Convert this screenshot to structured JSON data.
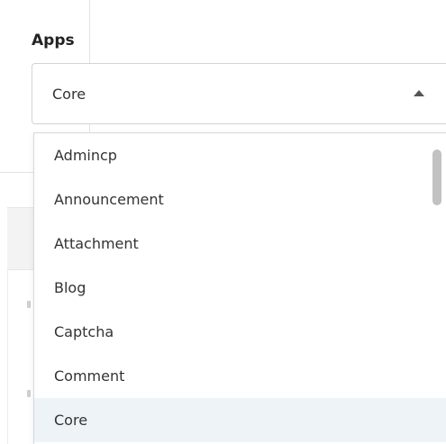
{
  "field": {
    "label": "Apps",
    "selected_value": "Core"
  },
  "dropdown": {
    "options": [
      {
        "label": "Admincp"
      },
      {
        "label": "Announcement"
      },
      {
        "label": "Attachment"
      },
      {
        "label": "Blog"
      },
      {
        "label": "Captcha"
      },
      {
        "label": "Comment"
      },
      {
        "label": "Core"
      }
    ],
    "selected_index": 6,
    "highlight_color": "#eef3f8"
  },
  "icons": {
    "toggle": "caret-up-icon"
  }
}
